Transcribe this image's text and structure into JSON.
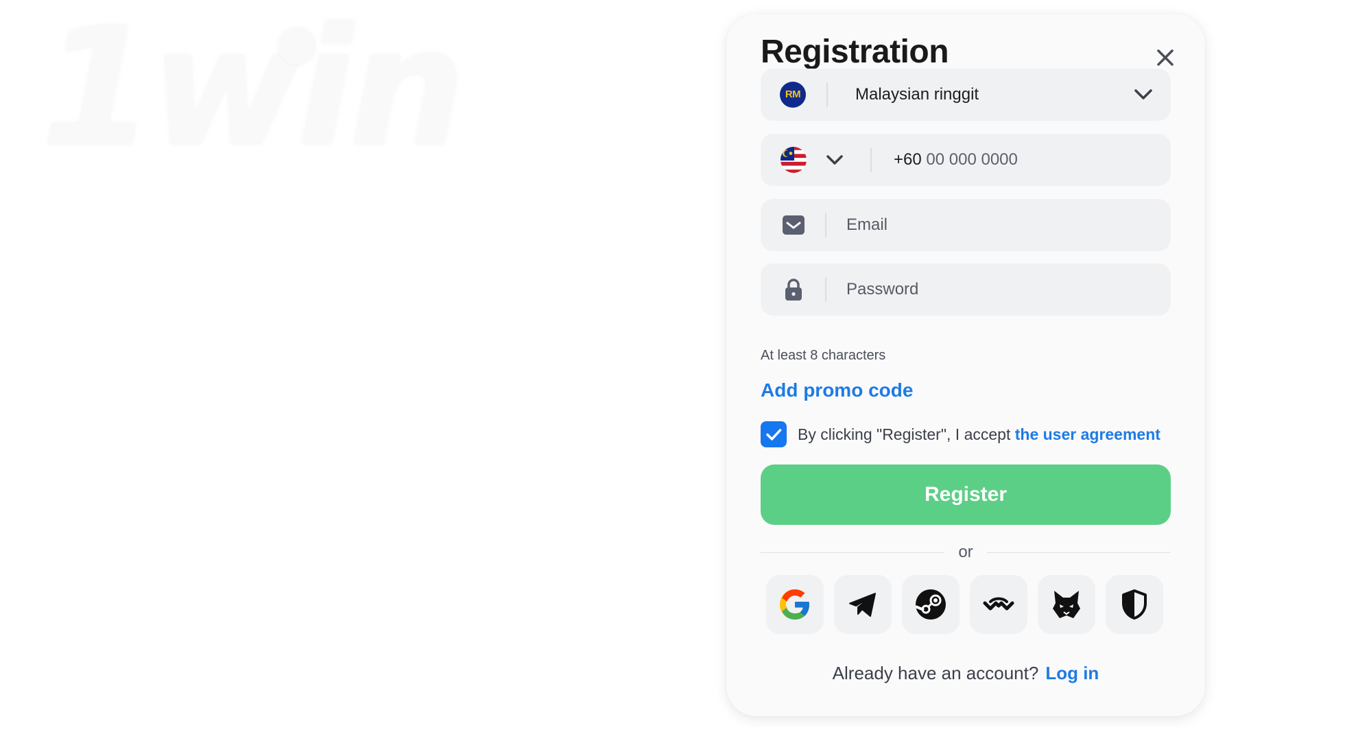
{
  "brand": {
    "logo_text": "1win"
  },
  "modal": {
    "title": "Registration",
    "close_label": "Close"
  },
  "currency": {
    "badge": "RM",
    "value": "Malaysian ringgit"
  },
  "phone": {
    "country": "Malaysia",
    "code": "+60",
    "placeholder": "00 000 0000"
  },
  "email": {
    "placeholder": "Email"
  },
  "password": {
    "placeholder": "Password",
    "hint": "At least 8 characters"
  },
  "promo": {
    "label": "Add promo code"
  },
  "agreement": {
    "checked": true,
    "text": "By clicking \"Register\", I accept ",
    "link": "the user agreement"
  },
  "register": {
    "label": "Register"
  },
  "divider": {
    "label": "or"
  },
  "social": [
    {
      "name": "Google",
      "icon": "google-icon"
    },
    {
      "name": "Telegram",
      "icon": "telegram-icon"
    },
    {
      "name": "Steam",
      "icon": "steam-icon"
    },
    {
      "name": "WalletConnect",
      "icon": "walletconnect-icon"
    },
    {
      "name": "MetaMask",
      "icon": "metamask-fox-icon"
    },
    {
      "name": "Security",
      "icon": "shield-icon"
    }
  ],
  "login": {
    "prompt": "Already have an account?",
    "link": "Log in"
  },
  "colors": {
    "accent_blue": "#1e7be3",
    "register_green": "#5ccf86",
    "checkbox_blue": "#1677ee"
  }
}
